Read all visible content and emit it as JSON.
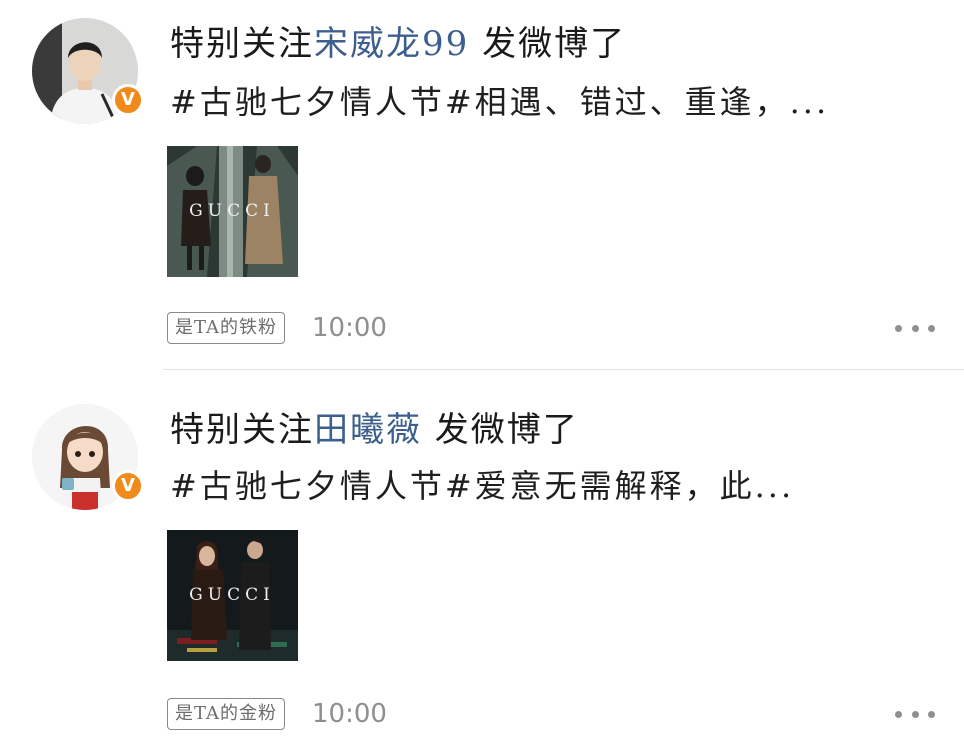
{
  "posts": [
    {
      "prefix": "特别关注",
      "user_name": "宋威龙99",
      "suffix": " 发微博了",
      "content": "#古驰七夕情人节#相遇、错过、重逢，...",
      "image_text": "GUCCI",
      "fan_badge": "是TA的铁粉",
      "time": "10:00",
      "avatar_badge": "V"
    },
    {
      "prefix": "特别关注",
      "user_name": "田曦薇",
      "suffix": " 发微博了",
      "content": "#古驰七夕情人节#爱意无需解释，此...",
      "image_text": "GUCCI",
      "fan_badge": "是TA的金粉",
      "time": "10:00",
      "avatar_badge": "V"
    }
  ],
  "colors": {
    "link_name": "#3c5f8e",
    "badge_orange": "#f08a1a",
    "meta_gray": "#8f8f8f"
  },
  "icons": {
    "more": "more-dots-icon",
    "verified": "verified-badge-icon"
  }
}
